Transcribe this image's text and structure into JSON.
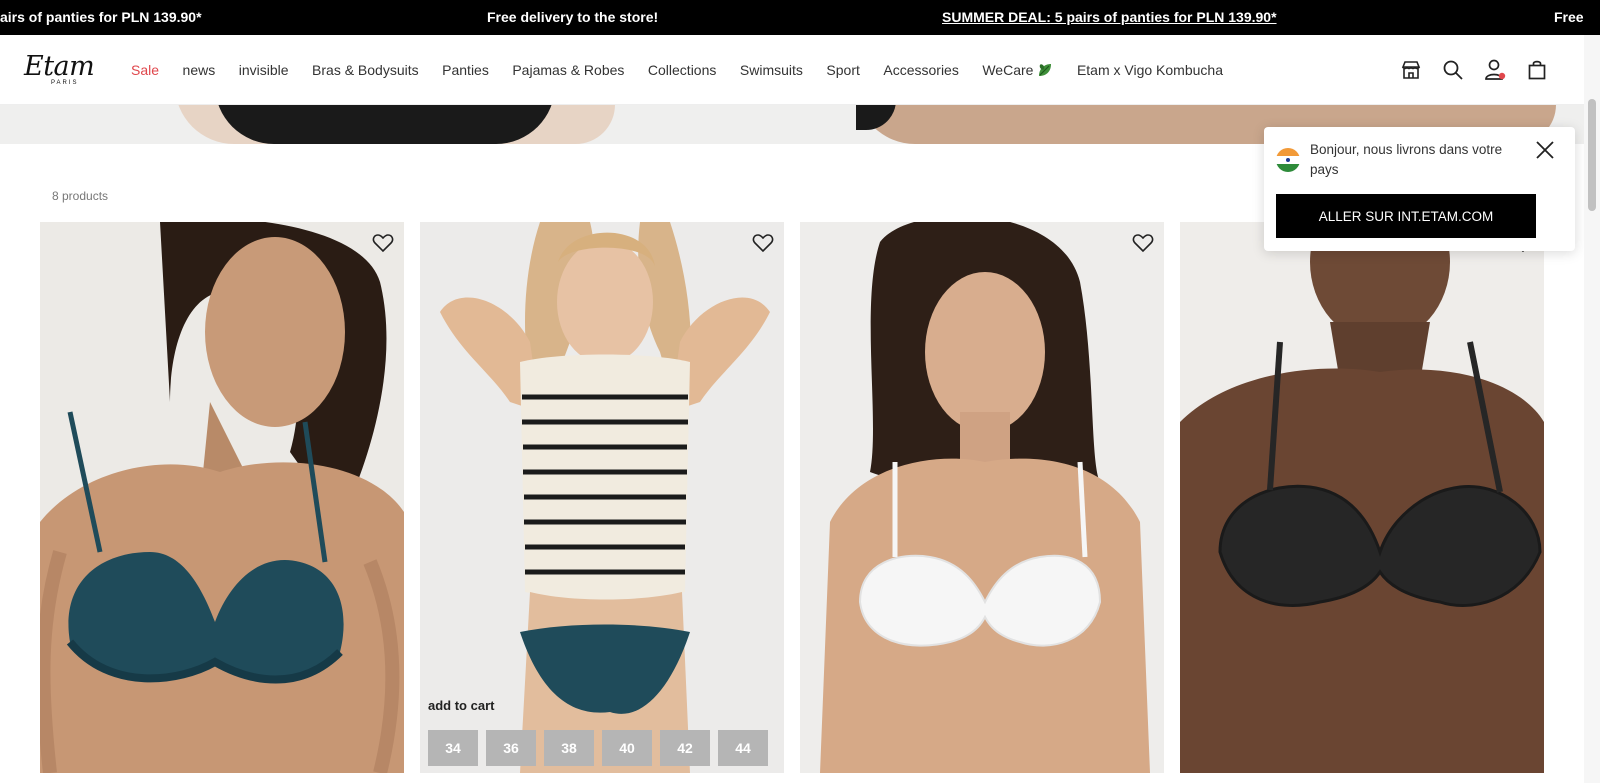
{
  "promo": {
    "text_left": "airs of panties for PLN 139.90*",
    "text_center": "Free delivery to the store!",
    "deal_label": "SUMMER DEAL:",
    "deal_text": " 5 pairs of panties for PLN 139.90*",
    "text_right": "Free"
  },
  "header": {
    "logo": "Etam",
    "logo_sub": "PARIS",
    "nav": [
      {
        "label": "Sale"
      },
      {
        "label": "news"
      },
      {
        "label": "invisible"
      },
      {
        "label": "Bras & Bodysuits"
      },
      {
        "label": "Panties"
      },
      {
        "label": "Pajamas & Robes"
      },
      {
        "label": "Collections"
      },
      {
        "label": "Swimsuits"
      },
      {
        "label": "Sport"
      },
      {
        "label": "Accessories"
      },
      {
        "label": "WeCare"
      },
      {
        "label": "Etam x Vigo Kombucha"
      }
    ],
    "icons": [
      "store-icon",
      "search-icon",
      "account-icon",
      "bag-icon"
    ]
  },
  "listing": {
    "product_count": "8 products",
    "products": [
      {
        "image": "model in teal lace push-up bra"
      },
      {
        "image": "model in striped knit top and teal lace panties",
        "add_to_cart": "add to cart",
        "sizes": [
          "34",
          "36",
          "38",
          "40",
          "42",
          "44"
        ]
      },
      {
        "image": "model in white lace balconette bra"
      },
      {
        "image": "model in black lace bra"
      }
    ]
  },
  "country_popup": {
    "message": "Bonjour, nous livrons dans votre pays",
    "button": "ALLER SUR INT.ETAM.COM"
  },
  "colors": {
    "sale": "#e0474c",
    "promo_bg": "#000000",
    "size_chip": "#b5b5b5"
  }
}
